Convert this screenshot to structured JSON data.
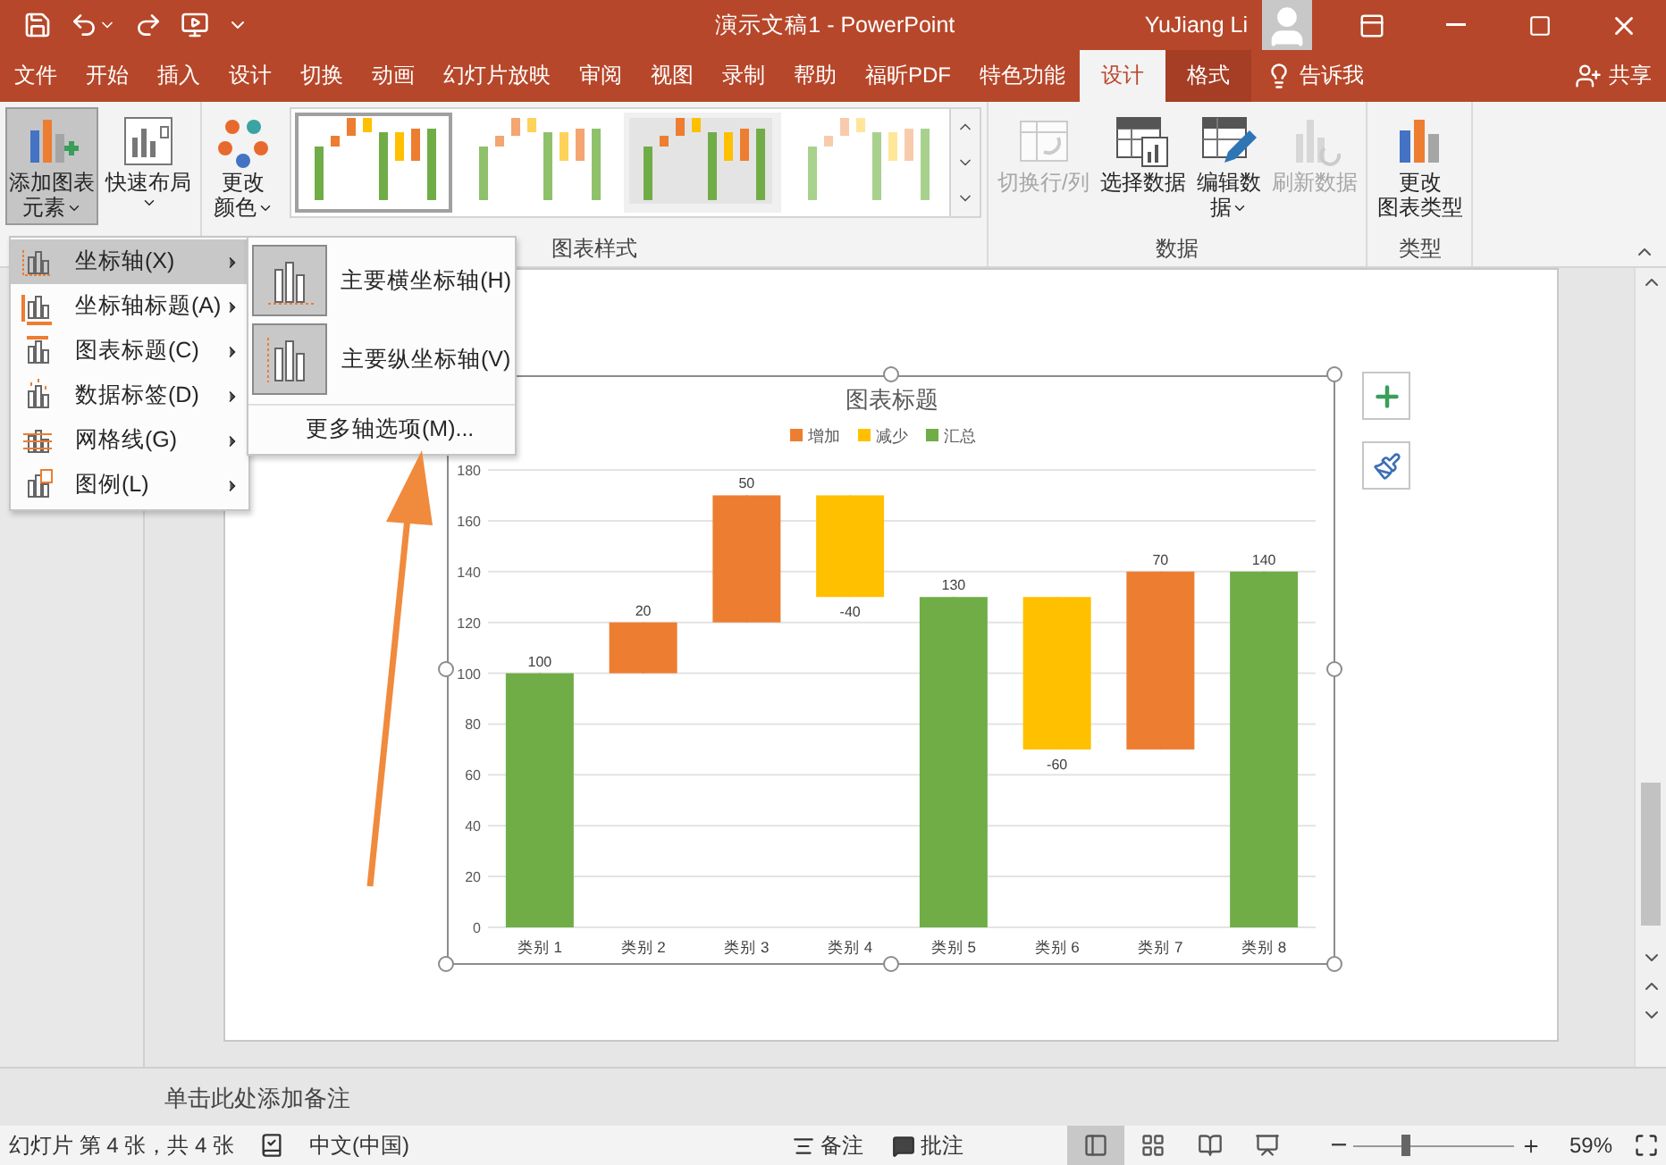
{
  "title_bar": {
    "title": "演示文稿1  -  PowerPoint",
    "user": "YuJiang Li"
  },
  "tabs": [
    {
      "label": "文件",
      "kind": "core",
      "selected": false
    },
    {
      "label": "开始",
      "kind": "core",
      "selected": false
    },
    {
      "label": "插入",
      "kind": "core",
      "selected": false
    },
    {
      "label": "设计",
      "kind": "core",
      "selected": false
    },
    {
      "label": "切换",
      "kind": "core",
      "selected": false
    },
    {
      "label": "动画",
      "kind": "core",
      "selected": false
    },
    {
      "label": "幻灯片放映",
      "kind": "core",
      "selected": false
    },
    {
      "label": "审阅",
      "kind": "core",
      "selected": false
    },
    {
      "label": "视图",
      "kind": "core",
      "selected": false
    },
    {
      "label": "录制",
      "kind": "core",
      "selected": false
    },
    {
      "label": "帮助",
      "kind": "core",
      "selected": false
    },
    {
      "label": "福昕PDF",
      "kind": "core",
      "selected": false
    },
    {
      "label": "特色功能",
      "kind": "core",
      "selected": false
    },
    {
      "label": "设计",
      "kind": "context",
      "selected": true
    },
    {
      "label": "格式",
      "kind": "context",
      "selected": false
    }
  ],
  "tell_me": "告诉我",
  "share": "共享",
  "ribbon": {
    "groups": [
      {
        "buttons": [
          {
            "kind": "add-element",
            "lines": [
              "添加图表",
              "元素"
            ],
            "dropdown": true,
            "pressed": true,
            "disabled": false
          },
          {
            "kind": "quick-layout",
            "lines": [
              "快速布局"
            ],
            "dropdown": true,
            "pressed": false,
            "disabled": false
          }
        ]
      },
      {
        "label": "图表样式",
        "buttons": [
          {
            "kind": "change-colors",
            "lines": [
              "更改",
              "颜色"
            ],
            "dropdown": true,
            "pressed": false,
            "disabled": false
          }
        ],
        "gallery": [
          {
            "kind": "white",
            "selected": true
          },
          {
            "kind": "striped",
            "selected": false
          },
          {
            "kind": "gray",
            "selected": false
          },
          {
            "kind": "faded",
            "selected": false
          }
        ]
      },
      {
        "label": "数据",
        "buttons": [
          {
            "kind": "switch",
            "lines": [
              "切换行/列"
            ],
            "dropdown": false,
            "pressed": false,
            "disabled": true
          },
          {
            "kind": "select-data",
            "lines": [
              "选择数据"
            ],
            "dropdown": false,
            "pressed": false,
            "disabled": false
          },
          {
            "kind": "edit-data",
            "lines": [
              "编辑数",
              "据"
            ],
            "dropdown": true,
            "pressed": false,
            "disabled": false
          },
          {
            "kind": "refresh",
            "lines": [
              "刷新数据"
            ],
            "dropdown": false,
            "pressed": false,
            "disabled": true
          }
        ]
      },
      {
        "label": "类型",
        "buttons": [
          {
            "kind": "change-type",
            "lines": [
              "更改",
              "图表类型"
            ],
            "dropdown": false,
            "pressed": false,
            "disabled": false
          }
        ]
      }
    ]
  },
  "menu": {
    "items": [
      {
        "label": "坐标轴(X)",
        "kind": "axes",
        "selected": true
      },
      {
        "label": "坐标轴标题(A)",
        "kind": "axis-titles",
        "selected": false
      },
      {
        "label": "图表标题(C)",
        "kind": "chart-title",
        "selected": false
      },
      {
        "label": "数据标签(D)",
        "kind": "data-labels",
        "selected": false
      },
      {
        "label": "网格线(G)",
        "kind": "gridlines",
        "selected": false
      },
      {
        "label": "图例(L)",
        "kind": "legend",
        "selected": false
      }
    ],
    "submenu": {
      "options": [
        {
          "label": "主要横坐标轴(H)",
          "kind": "horizontal",
          "checked": true
        },
        {
          "label": "主要纵坐标轴(V)",
          "kind": "vertical",
          "checked": true
        }
      ],
      "more": "更多轴选项(M)..."
    }
  },
  "slide": {
    "chart": {
      "chart_data": {
        "type": "candlestick",
        "title": "图表标题",
        "categories": [
          "类别 1",
          "类别 2",
          "类别 3",
          "类别 4",
          "类别 5",
          "类别 6",
          "类别 7",
          "类别 8"
        ],
        "grid": true,
        "legend": true,
        "series": [
          {
            "name": "增加",
            "color": "#ed7d31",
            "ohlc": [
              null,
              [
                100,
                120,
                100,
                120
              ],
              [
                120,
                170,
                120,
                170
              ],
              null,
              null,
              null,
              [
                70,
                140,
                70,
                140
              ],
              null
            ],
            "value_labels": [
              null,
              "20",
              "50",
              null,
              null,
              null,
              "70",
              null
            ]
          },
          {
            "name": "减少",
            "color": "#ffc000",
            "ohlc": [
              null,
              null,
              null,
              [
                170,
                170,
                130,
                130
              ],
              null,
              [
                130,
                130,
                70,
                70
              ],
              null,
              null
            ],
            "value_labels": [
              null,
              null,
              null,
              "-40",
              null,
              "-60",
              null,
              null
            ]
          },
          {
            "name": "汇总",
            "color": "#70ad47",
            "ohlc": [
              [
                0,
                100,
                0,
                100
              ],
              null,
              null,
              null,
              [
                0,
                130,
                0,
                130
              ],
              null,
              null,
              [
                0,
                140,
                0,
                140
              ]
            ],
            "value_labels": [
              "100",
              null,
              null,
              null,
              "130",
              null,
              null,
              "140"
            ]
          }
        ],
        "ylim": [
          0,
          180
        ],
        "yticks": [
          0,
          20,
          40,
          60,
          80,
          100,
          120,
          140,
          160,
          180
        ]
      }
    }
  },
  "notes": {
    "placeholder": "单击此处添加备注"
  },
  "status_bar": {
    "slide_info": "幻灯片 第 4 张，共 4 张",
    "language": "中文(中国)",
    "notes": "备注",
    "comments": "批注",
    "views": [
      {
        "kind": "normal",
        "selected": true
      },
      {
        "kind": "sorter",
        "selected": false
      },
      {
        "kind": "reading",
        "selected": false
      },
      {
        "kind": "slideshow",
        "selected": false
      }
    ],
    "zoom": {
      "level": 0.3,
      "reading": "59%"
    }
  }
}
